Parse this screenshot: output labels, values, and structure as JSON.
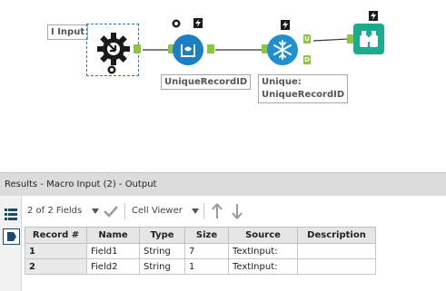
{
  "canvas": {
    "input_tool_label": "I Input",
    "unique_id_label": "UniqueRecordID",
    "unique_label_line1": "Unique:",
    "unique_label_line2": "UniqueRecordID",
    "anchor_unique": "U",
    "anchor_duplicate": "D",
    "colors": {
      "anchor_green": "#8cc63f",
      "formula_blue": "#1b7fc4",
      "unique_blue": "#1f8fd0",
      "browse_teal": "#1bab8f",
      "selection": "#2b79c2"
    },
    "icons": [
      "macro-input-gear-icon",
      "record-id-icon",
      "unique-snowflake-icon",
      "browse-binoculars-icon",
      "lightning-icon",
      "q-badge-icon"
    ]
  },
  "results": {
    "title": "Results - Macro Input (2) - Output",
    "toolbar": {
      "fields_selector": "2 of 2 Fields",
      "cell_viewer": "Cell Viewer"
    },
    "columns": [
      "Record #",
      "Name",
      "Type",
      "Size",
      "Source",
      "Description"
    ],
    "rows": [
      [
        "1",
        "Field1",
        "String",
        "7",
        "TextInput:",
        ""
      ],
      [
        "2",
        "Field2",
        "String",
        "1",
        "TextInput:",
        ""
      ]
    ]
  }
}
